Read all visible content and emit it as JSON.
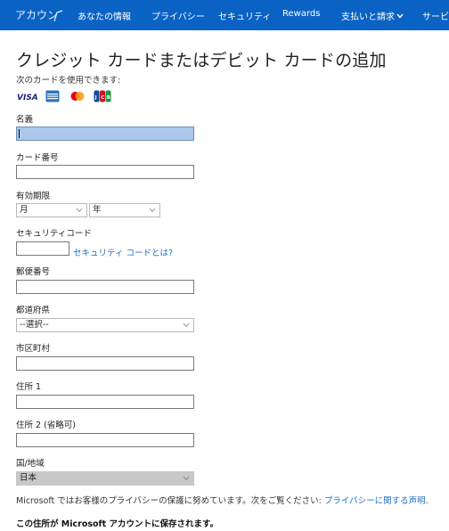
{
  "nav": {
    "brand": "アカウン",
    "items": [
      {
        "label": "あなたの情報"
      },
      {
        "label": "プライバシー"
      },
      {
        "label": "セキュリティ"
      },
      {
        "label": "Rewards"
      },
      {
        "label": "支払いと請求"
      },
      {
        "label": "サービ"
      }
    ]
  },
  "page": {
    "title": "クレジット カードまたはデビット カードの追加",
    "subtitle": "次のカードを使用できます:",
    "cards": [
      "VISA",
      "AMEX",
      "Mastercard",
      "JCB"
    ]
  },
  "form": {
    "name_label": "名義",
    "card_number_label": "カード番号",
    "expiry_label": "有効期限",
    "month": "月",
    "year": "年",
    "security_code_label": "セキュリティコード",
    "security_code_link": "セキュリティ コードとは?",
    "postal_label": "郵便番号",
    "prefecture_label": "都道府県",
    "prefecture_value": "--選択--",
    "city_label": "市区町村",
    "address1_label": "住所 1",
    "address2_label": "住所 2 (省略可)",
    "country_label": "国/地域",
    "country_value": "日本"
  },
  "footer": {
    "privacy_text": "Microsoft ではお客様のプライバシーの保護に努めています。次をご覧ください: ",
    "privacy_link": "プライバシーに関する声明",
    "privacy_end": ".",
    "save_note": "この住所が Microsoft アカウントに保存されます。"
  },
  "colors": {
    "nav_bg": "#0a63c4",
    "link": "#1f6fc8",
    "focus_fill": "#a9c8ea",
    "visa": "#1a1f71",
    "amex": "#2e77bc",
    "mc_red": "#eb001b",
    "mc_yellow": "#f79e1b",
    "jcb_blue": "#0e4c96",
    "jcb_red": "#cf1322",
    "jcb_green": "#1a9b3c"
  }
}
